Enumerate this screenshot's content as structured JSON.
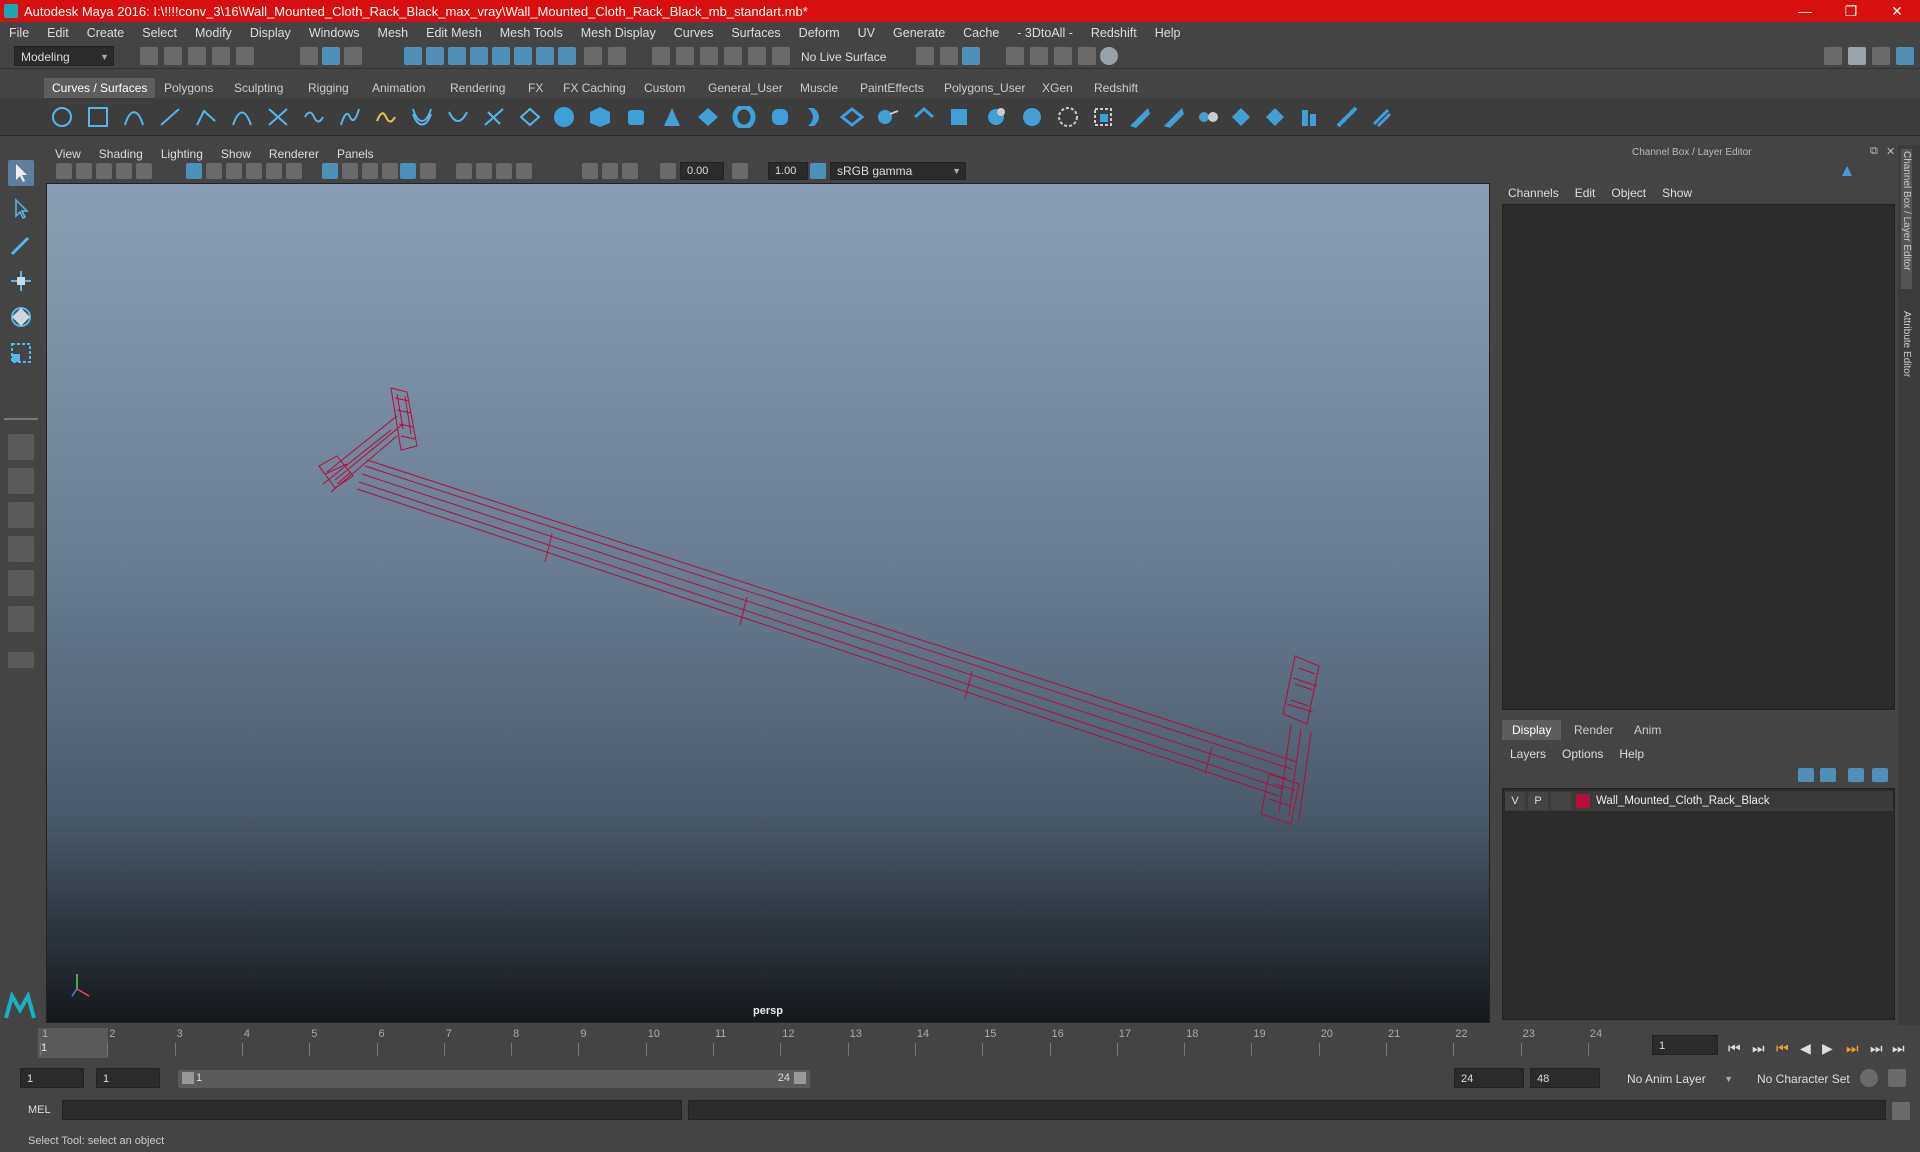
{
  "window": {
    "title": "Autodesk Maya 2016: I:\\!!!!conv_3\\16\\Wall_Mounted_Cloth_Rack_Black_max_vray\\Wall_Mounted_Cloth_Rack_Black_mb_standart.mb*",
    "minimize": "—",
    "maximize": "❐",
    "close": "✕"
  },
  "menubar": [
    "File",
    "Edit",
    "Create",
    "Select",
    "Modify",
    "Display",
    "Windows",
    "Mesh",
    "Edit Mesh",
    "Mesh Tools",
    "Mesh Display",
    "Curves",
    "Surfaces",
    "Deform",
    "UV",
    "Generate",
    "Cache",
    "- 3DtoAll -",
    "Redshift",
    "Help"
  ],
  "statusline": {
    "mode": "Modeling",
    "live_surface": "No Live Surface"
  },
  "shelf_tabs": [
    {
      "label": "Curves / Surfaces",
      "active": true
    },
    {
      "label": "Polygons",
      "active": false
    },
    {
      "label": "Sculpting",
      "active": false
    },
    {
      "label": "Rigging",
      "active": false
    },
    {
      "label": "Animation",
      "active": false
    },
    {
      "label": "Rendering",
      "active": false
    },
    {
      "label": "FX",
      "active": false
    },
    {
      "label": "FX Caching",
      "active": false
    },
    {
      "label": "Custom",
      "active": false
    },
    {
      "label": "General_User",
      "active": false
    },
    {
      "label": "Muscle",
      "active": false
    },
    {
      "label": "PaintEffects",
      "active": false
    },
    {
      "label": "Polygons_User",
      "active": false
    },
    {
      "label": "XGen",
      "active": false
    },
    {
      "label": "Redshift",
      "active": false
    }
  ],
  "viewport": {
    "menu": [
      "View",
      "Shading",
      "Lighting",
      "Show",
      "Renderer",
      "Panels"
    ],
    "exposure": "0.00",
    "gamma": "1.00",
    "colorspace": "sRGB gamma",
    "camera": "persp",
    "mesh_color": "#b0103a"
  },
  "channelbox": {
    "title": "Channel Box / Layer Editor",
    "menu": [
      "Channels",
      "Edit",
      "Object",
      "Show"
    ],
    "side_tab_1": "Channel Box / Layer Editor",
    "side_tab_2": "Attribute Editor"
  },
  "layers": {
    "tabs": [
      {
        "label": "Display",
        "active": true
      },
      {
        "label": "Render",
        "active": false
      },
      {
        "label": "Anim",
        "active": false
      }
    ],
    "menu": [
      "Layers",
      "Options",
      "Help"
    ],
    "row": {
      "v": "V",
      "p": "P",
      "name": "Wall_Mounted_Cloth_Rack_Black",
      "color": "#b0103a"
    }
  },
  "timeline": {
    "ticks": [
      "1",
      "2",
      "3",
      "4",
      "5",
      "6",
      "7",
      "8",
      "9",
      "10",
      "11",
      "12",
      "13",
      "14",
      "15",
      "16",
      "17",
      "18",
      "19",
      "20",
      "21",
      "22",
      "23",
      "24"
    ],
    "current_frame_marker": "1",
    "current_frame_field": "1"
  },
  "range": {
    "start": "1",
    "playback_start": "1",
    "slider_start": "1",
    "slider_end": "24",
    "playback_end": "24",
    "end": "48",
    "anim_layer": "No Anim Layer",
    "character_set": "No Character Set"
  },
  "command": {
    "lang": "MEL"
  },
  "help": {
    "text": "Select Tool: select an object"
  }
}
